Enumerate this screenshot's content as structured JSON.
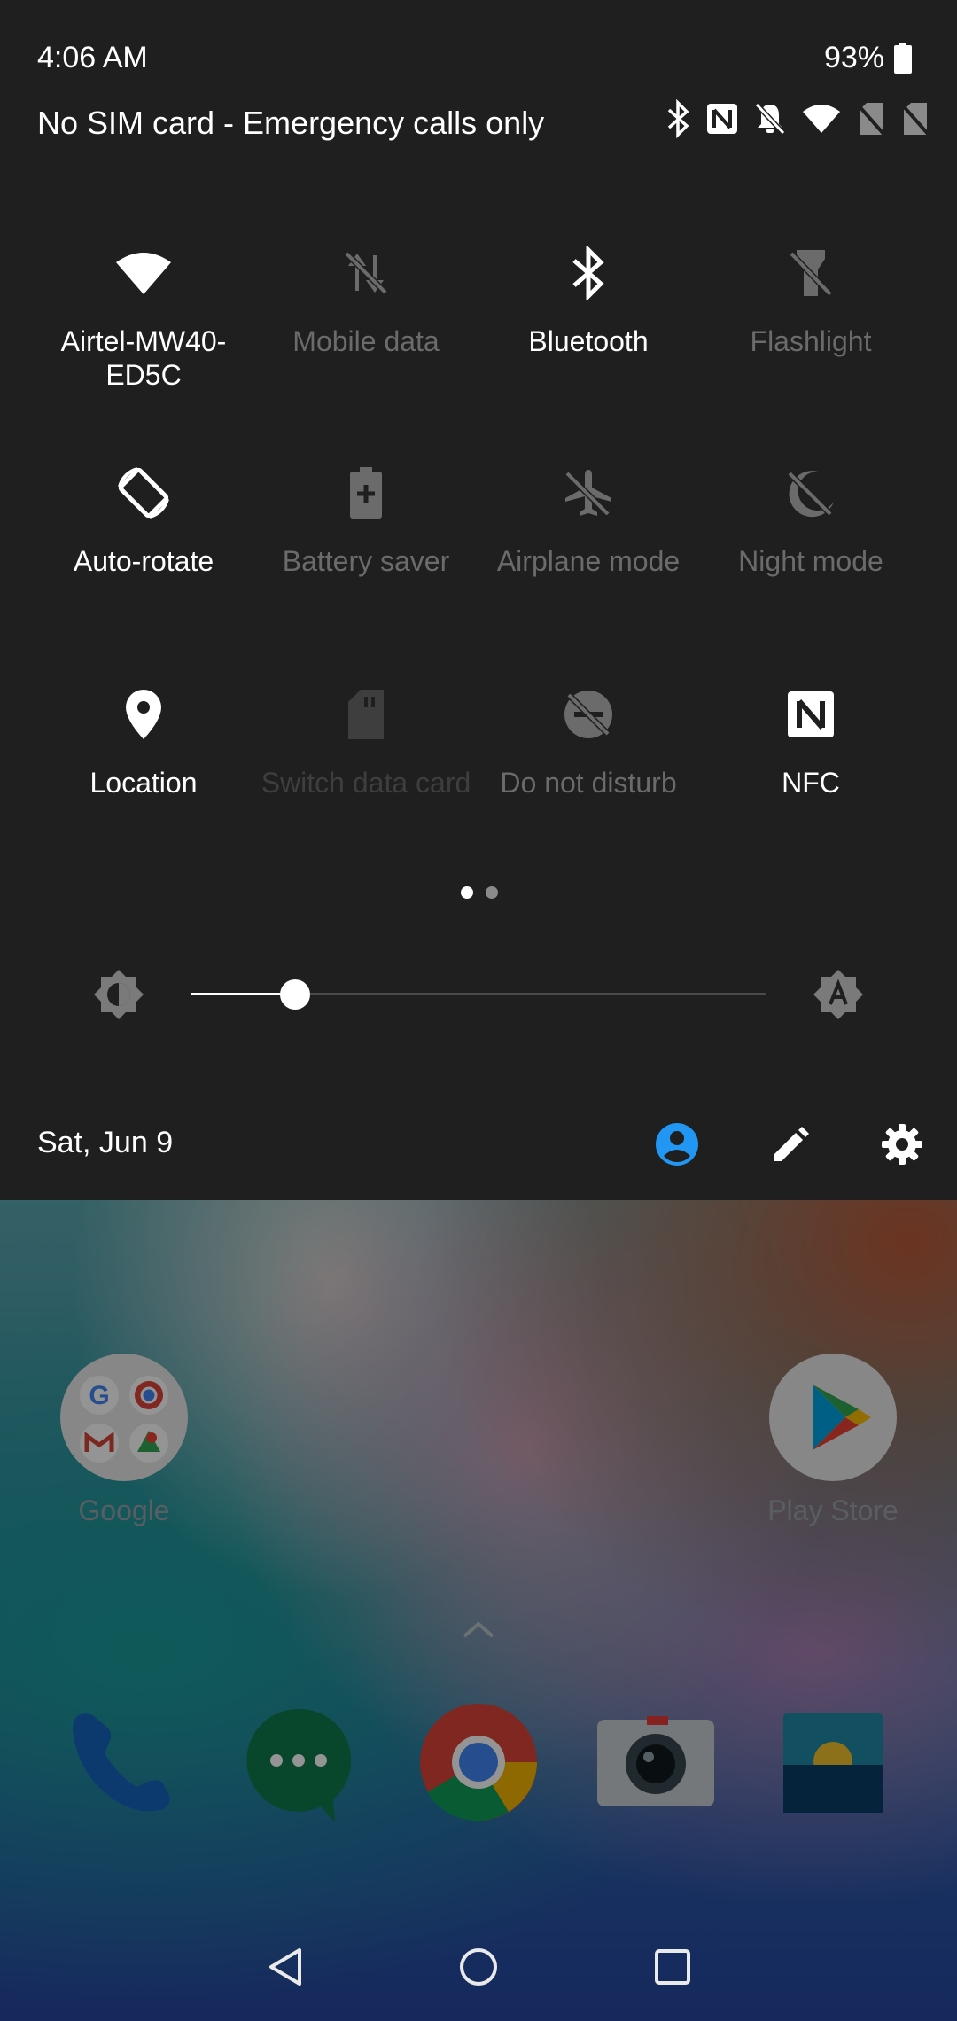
{
  "status_bar": {
    "time": "4:06 AM",
    "battery": "93%",
    "carrier": "No SIM card - Emergency calls only"
  },
  "tiles": [
    {
      "label": "Airtel-MW40-ED5C",
      "state": "on",
      "icon": "wifi-icon"
    },
    {
      "label": "Mobile data",
      "state": "off",
      "icon": "mobile-data-off-icon"
    },
    {
      "label": "Bluetooth",
      "state": "on",
      "icon": "bluetooth-icon"
    },
    {
      "label": "Flashlight",
      "state": "off",
      "icon": "flashlight-off-icon"
    },
    {
      "label": "Auto-rotate",
      "state": "on",
      "icon": "auto-rotate-icon"
    },
    {
      "label": "Battery saver",
      "state": "off",
      "icon": "battery-saver-icon"
    },
    {
      "label": "Airplane mode",
      "state": "off",
      "icon": "airplane-off-icon"
    },
    {
      "label": "Night mode",
      "state": "off",
      "icon": "night-mode-off-icon"
    },
    {
      "label": "Location",
      "state": "on",
      "icon": "location-icon"
    },
    {
      "label": "Switch data card",
      "state": "disabled",
      "icon": "sim-card-icon"
    },
    {
      "label": "Do not disturb",
      "state": "off",
      "icon": "dnd-off-icon"
    },
    {
      "label": "NFC",
      "state": "on",
      "icon": "nfc-icon"
    }
  ],
  "pagination": {
    "pages": 2,
    "current": 1
  },
  "brightness": {
    "level": 0.18
  },
  "footer": {
    "date": "Sat, Jun 9"
  },
  "home": {
    "apps": [
      {
        "label": "Google",
        "icon": "google-folder-icon"
      },
      {
        "label": "Play Store",
        "icon": "play-store-icon"
      }
    ],
    "dock": [
      "phone-icon",
      "messages-icon",
      "chrome-icon",
      "camera-icon",
      "gallery-icon"
    ]
  },
  "colors": {
    "panel_bg": "#1f1f1f",
    "tile_on": "#ffffff",
    "tile_off": "#6b6b6b",
    "accent": "#2196f3"
  }
}
